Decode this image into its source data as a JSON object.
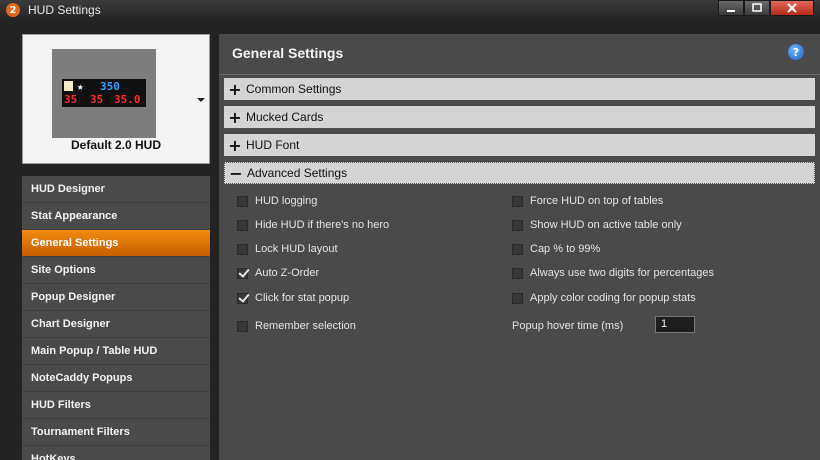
{
  "window": {
    "title": "HUD Settings",
    "app_icon": "2"
  },
  "preview": {
    "label": "Default 2.0 HUD",
    "hud_star": "★",
    "hud_top_value": "350",
    "hud_stats": [
      "35",
      "35",
      "35.0"
    ]
  },
  "sidebar": {
    "items": [
      {
        "label": "HUD Designer",
        "active": false
      },
      {
        "label": "Stat Appearance",
        "active": false
      },
      {
        "label": "General Settings",
        "active": true
      },
      {
        "label": "Site Options",
        "active": false
      },
      {
        "label": "Popup Designer",
        "active": false
      },
      {
        "label": "Chart Designer",
        "active": false
      },
      {
        "label": "Main Popup / Table HUD",
        "active": false
      },
      {
        "label": "NoteCaddy Popups",
        "active": false
      },
      {
        "label": "HUD Filters",
        "active": false
      },
      {
        "label": "Tournament Filters",
        "active": false
      },
      {
        "label": "HotKeys",
        "active": false
      }
    ]
  },
  "main": {
    "title": "General Settings",
    "help_icon": "?",
    "sections": [
      {
        "label": "Common Settings",
        "sign": "+",
        "open": false
      },
      {
        "label": "Mucked Cards",
        "sign": "+",
        "open": false
      },
      {
        "label": "HUD Font",
        "sign": "+",
        "open": false
      },
      {
        "label": "Advanced Settings",
        "sign": "−",
        "open": true
      }
    ],
    "options_left": [
      {
        "label": "HUD logging",
        "checked": false
      },
      {
        "label": "Hide HUD if there's no hero",
        "checked": false
      },
      {
        "label": "Lock HUD layout",
        "checked": false
      },
      {
        "label": "Auto Z-Order",
        "checked": true
      },
      {
        "label": "Click for stat popup",
        "checked": true
      },
      {
        "label": "Remember selection",
        "checked": false
      }
    ],
    "options_right": [
      {
        "label": "Force HUD on top of tables",
        "checked": false
      },
      {
        "label": "Show HUD on active table only",
        "checked": false
      },
      {
        "label": "Cap % to 99%",
        "checked": false
      },
      {
        "label": "Always use two digits for percentages",
        "checked": false
      },
      {
        "label": "Apply color coding for popup stats",
        "checked": false
      }
    ],
    "popup_hover": {
      "label": "Popup hover time (ms)",
      "value": "1"
    }
  }
}
